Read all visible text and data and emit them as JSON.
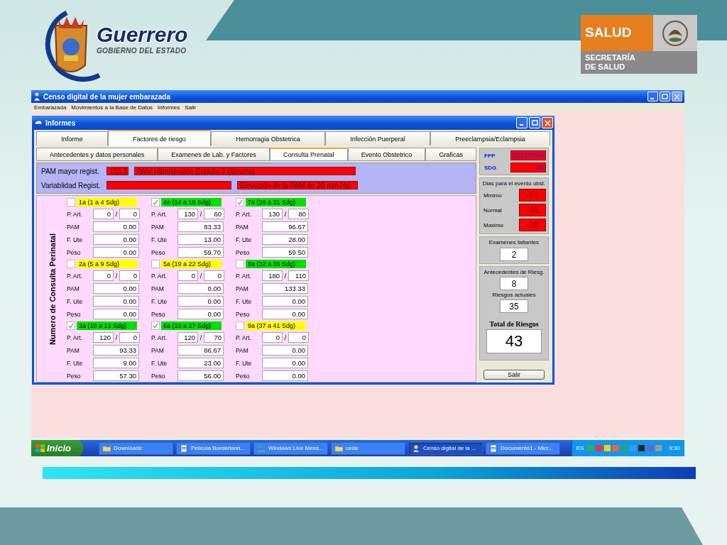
{
  "header": {
    "brand": "Guerrero",
    "subtitle": "GOBIERNO DEL ESTADO",
    "agency_badge": "SALUD",
    "agency_lines": [
      "SECRETARÍA",
      "DE SALUD"
    ]
  },
  "app": {
    "title": "Censo digital de la mujer embarazada",
    "menu": [
      "Embarazada",
      "Movimientos a la Base de Datos",
      "Informes",
      "Salir"
    ]
  },
  "dialog": {
    "title": "Informes",
    "tabs": [
      {
        "label": "Informe",
        "selected": false
      },
      {
        "label": "Factores de riesgo",
        "selected": true
      },
      {
        "label": "Hemorragia Obstetrica",
        "selected": false
      },
      {
        "label": "Infección Puerperal",
        "selected": false
      },
      {
        "label": "Preeclampsia/Eclampsia",
        "selected": false
      }
    ],
    "subtabs": [
      {
        "label": "Antecedentes y datos personales",
        "selected": false
      },
      {
        "label": "Examenes de Lab. y Factores",
        "selected": false
      },
      {
        "label": "Consulta Prenatal",
        "selected": true
      },
      {
        "label": "Evento Obstetrico",
        "selected": false
      },
      {
        "label": "Graficas",
        "selected": false
      }
    ],
    "summary": [
      {
        "label": "PAM mayor regist.",
        "value": "133.3",
        "alert": "PAM Hipertensión Estadio 3 (Severa)"
      },
      {
        "label": "Variablidad Regist.",
        "alert": "Elevación de la PAM de 20 mm Hg"
      }
    ],
    "vertical_label": "Numero de Consulta Perinatal",
    "consultations": [
      {
        "label": "1a (1 a 4 Sdg)",
        "checked": false,
        "color": "#ffff00",
        "fields": [
          {
            "label": "P. Art.",
            "values": [
              "0",
              "0"
            ],
            "separator": "/"
          },
          {
            "label": "PAM",
            "value": "0.00"
          },
          {
            "label": "F. Ute",
            "value": "0.00"
          },
          {
            "label": "Peso",
            "value": "0.00"
          }
        ]
      },
      {
        "label": "4a (14 a 18 Sdg)",
        "checked": true,
        "color": "#00e000",
        "fields": [
          {
            "label": "P. Art.",
            "values": [
              "130",
              "60"
            ],
            "separator": "/"
          },
          {
            "label": "PAM",
            "value": "83.33"
          },
          {
            "label": "F. Ute",
            "value": "13.00"
          },
          {
            "label": "Peso",
            "value": "59.70"
          }
        ]
      },
      {
        "label": "7a (28 a 31 Sdg)",
        "checked": true,
        "color": "#00e000",
        "fields": [
          {
            "label": "P. Art.",
            "values": [
              "130",
              "80"
            ],
            "separator": "/"
          },
          {
            "label": "PAM",
            "value": "96.67"
          },
          {
            "label": "F. Ute",
            "value": "28.00"
          },
          {
            "label": "Peso",
            "value": "59.50"
          }
        ]
      },
      {
        "label": "2a (5 a 9 Sdg)",
        "checked": false,
        "color": "#ffff00",
        "fields": [
          {
            "label": "P. Art.",
            "values": [
              "0",
              "0"
            ],
            "separator": "/"
          },
          {
            "label": "PAM",
            "value": "0.00"
          },
          {
            "label": "F. Ute",
            "value": "0.00"
          },
          {
            "label": "Peso",
            "value": "0.00"
          }
        ]
      },
      {
        "label": "5a (19 a 22 Sdg)",
        "checked": false,
        "color": "#ffff00",
        "fields": [
          {
            "label": "P. Art.",
            "values": [
              "0",
              "0"
            ],
            "separator": "/"
          },
          {
            "label": "PAM",
            "value": "0.00"
          },
          {
            "label": "F. Ute",
            "value": "0.00"
          },
          {
            "label": "Peso",
            "value": "0.00"
          }
        ]
      },
      {
        "label": "8a (32 a 36 Sdg)",
        "checked": false,
        "color": "#00e000",
        "fields": [
          {
            "label": "P. Art.",
            "values": [
              "180",
              "110"
            ],
            "separator": "/"
          },
          {
            "label": "PAM",
            "value": "133.33"
          },
          {
            "label": "F. Ute",
            "value": "0.00"
          },
          {
            "label": "Peso",
            "value": "0.00"
          }
        ]
      },
      {
        "label": "3a (10 a 13 Sdg)",
        "checked": true,
        "color": "#00e000",
        "fields": [
          {
            "label": "P. Art.",
            "values": [
              "120",
              "0"
            ],
            "separator": "/"
          },
          {
            "label": "PAM",
            "value": "93.33"
          },
          {
            "label": "F. Ute",
            "value": "9.00"
          },
          {
            "label": "Peso",
            "value": "57.30"
          }
        ]
      },
      {
        "label": "6a (23 a 27 Sdg)",
        "checked": true,
        "color": "#00e000",
        "fields": [
          {
            "label": "P. Art.",
            "values": [
              "120",
              "70"
            ],
            "separator": "/"
          },
          {
            "label": "PAM",
            "value": "86.67"
          },
          {
            "label": "F. Ute",
            "value": "23.00"
          },
          {
            "label": "Peso",
            "value": "56.00"
          }
        ]
      },
      {
        "label": "9a (37 a 41 Sdg)",
        "checked": false,
        "color": "#ffff00",
        "fields": [
          {
            "label": "P. Art.",
            "values": [
              "0",
              "0"
            ],
            "separator": "/"
          },
          {
            "label": "PAM",
            "value": "0.00"
          },
          {
            "label": "F. Ute",
            "value": "0.00"
          },
          {
            "label": "Peso",
            "value": "0.00"
          }
        ]
      }
    ],
    "side": {
      "fpp_label": "FPP",
      "fpp": "25/12/2009",
      "sdg_label": "SDG",
      "sdg": "46",
      "days_title": "Dias para el evento obst.",
      "days": [
        {
          "label": "Minimo",
          "value": "-52"
        },
        {
          "label": "Normal",
          "value": "-45"
        },
        {
          "label": "Maximo",
          "value": "-38"
        }
      ],
      "missing_label": "Examenes faltantes",
      "missing": "2",
      "history_label": "Antecedentes de Riesg.",
      "history": "8",
      "current_label": "Riesgos actuales",
      "current": "35",
      "total_label": "Total de Riesgos",
      "total": "43",
      "exit": "Salir"
    }
  },
  "taskbar": {
    "start": "Inicio",
    "items": [
      {
        "label": "Downloads",
        "kind": "folder",
        "selected": false
      },
      {
        "label": "Pelicula Borderland...",
        "kind": "document",
        "selected": false
      },
      {
        "label": "Windows Live Mess...",
        "kind": "chat",
        "selected": false
      },
      {
        "label": "cede",
        "kind": "folder",
        "selected": false
      },
      {
        "label": "Censo digital de la ...",
        "kind": "person",
        "selected": true
      },
      {
        "label": "Documento1 - Micr...",
        "kind": "document",
        "selected": false
      }
    ],
    "language": "ES",
    "clock": "9:30"
  }
}
